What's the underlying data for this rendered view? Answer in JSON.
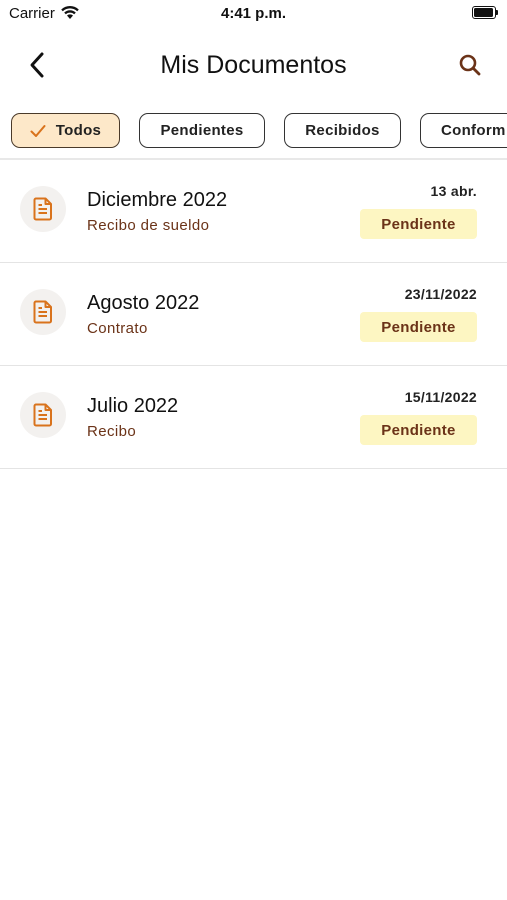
{
  "status_bar": {
    "carrier": "Carrier",
    "time": "4:41 p.m."
  },
  "nav": {
    "title": "Mis Documentos",
    "back_icon": "chevron-left-icon",
    "search_icon": "search-icon"
  },
  "filters": [
    {
      "label": "Todos",
      "selected": true
    },
    {
      "label": "Pendientes",
      "selected": false
    },
    {
      "label": "Recibidos",
      "selected": false
    },
    {
      "label": "Conform",
      "selected": false
    }
  ],
  "documents": [
    {
      "title": "Diciembre 2022",
      "subtitle": "Recibo de sueldo",
      "date": "13 abr.",
      "status": "Pendiente"
    },
    {
      "title": "Agosto 2022",
      "subtitle": "Contrato",
      "date": "23/11/2022",
      "status": "Pendiente"
    },
    {
      "title": "Julio 2022",
      "subtitle": "Recibo",
      "date": "15/11/2022",
      "status": "Pendiente"
    }
  ],
  "colors": {
    "accent": "#d9731c",
    "chip_active_bg": "#fde8c9",
    "badge_bg": "#fdf6c2",
    "badge_text": "#6b3318"
  }
}
